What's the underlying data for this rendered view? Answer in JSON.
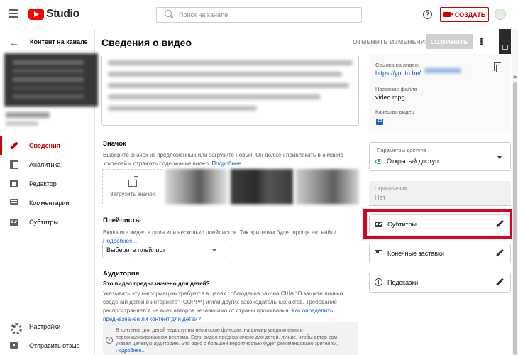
{
  "header": {
    "logo_text": "Studio",
    "search_placeholder": "Поиск на канале",
    "help": "?",
    "create_label": "СОЗДАТЬ"
  },
  "sidebar": {
    "channel_title": "Контент на канале",
    "items": [
      {
        "label": "Сведения",
        "icon": "pencil-icon",
        "active": true
      },
      {
        "label": "Аналитика",
        "icon": "analytics-icon"
      },
      {
        "label": "Редактор",
        "icon": "editor-icon"
      },
      {
        "label": "Комментарии",
        "icon": "comments-icon"
      },
      {
        "label": "Субтитры",
        "icon": "subtitles-icon"
      }
    ],
    "bottom_items": [
      {
        "label": "Настройки",
        "icon": "gear-icon"
      },
      {
        "label": "Отправить отзыв",
        "icon": "feedback-icon"
      }
    ]
  },
  "main": {
    "title": "Сведения о видео",
    "undo_label": "ОТМЕНИТЬ ИЗМЕНЕНИЯ",
    "save_label": "СОХРАНИТЬ",
    "thumbnail": {
      "title": "Значок",
      "desc": "Выберите значок из предложенных или загрузите новый. Он должен привлекать внимание зрителей и отражать содержание видео.",
      "more": "Подробнее...",
      "upload_label": "Загрузить значок"
    },
    "playlists": {
      "title": "Плейлисты",
      "desc": "Включите видео в один или несколько плейлистов. Так зрителям будет проще его найти.",
      "more": "Подробнее...",
      "select_label": "Выберите плейлист"
    },
    "audience": {
      "title": "Аудитория",
      "question": "Это видео предназначено для детей?",
      "desc_1": "Указывать эту информацию требуется в целях соблюдения закона США \"О защите личных сведений детей в интернете\" (COPPA) и/или других законодательных актов. Требование распространяется на всех авторов независимо от страны проживания.",
      "desc_link": "Как определить, предназначен ли контент для детей?",
      "note": "В контенте для детей недоступны некоторые функции, например уведомления и персонализированная реклама. Если видео предназначено для детей, лучше, чтобы автор сам указал целевую аудиторию. Это одно с большей вероятностью будет рекомендовано зрителям,",
      "note_more": "Подробнее..."
    }
  },
  "right": {
    "link_label": "Ссылка на видео:",
    "link_value": "https://youtu.be/",
    "filename_label": "Название файла",
    "filename_value": "video.mpg",
    "quality_label": "Качество видео",
    "quality_badge": "SD",
    "access_label": "Параметры доступа",
    "access_value": "Открытый доступ",
    "restrictions_label": "Ограничения",
    "restrictions_value": "Нет",
    "features": [
      {
        "label": "Субтитры",
        "icon": "subtitles-icon"
      },
      {
        "label": "Конечные заставки",
        "icon": "end-screen-icon"
      },
      {
        "label": "Подсказки",
        "icon": "info-icon"
      }
    ]
  },
  "colors": {
    "accent": "#cc0000",
    "highlight": "#e0001b",
    "link": "#065fd4",
    "public": "#0f9d58"
  }
}
